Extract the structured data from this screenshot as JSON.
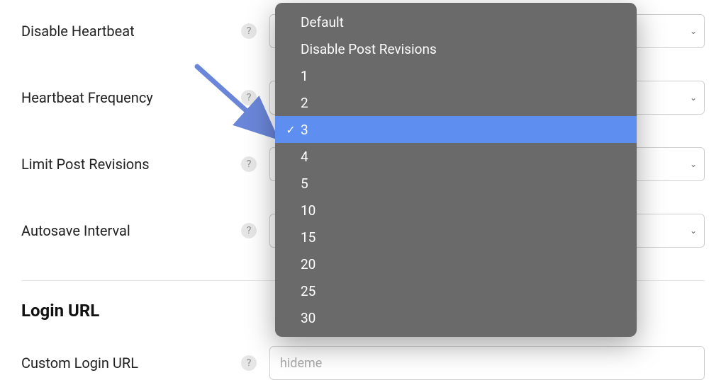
{
  "rows": [
    {
      "label": "Disable Heartbeat"
    },
    {
      "label": "Heartbeat Frequency"
    },
    {
      "label": "Limit Post Revisions"
    },
    {
      "label": "Autosave Interval"
    }
  ],
  "section_title": "Login URL",
  "custom_login": {
    "label": "Custom Login URL",
    "value": "hideme"
  },
  "dropdown": {
    "selected": "3",
    "options": [
      "Default",
      "Disable Post Revisions",
      "1",
      "2",
      "3",
      "4",
      "5",
      "10",
      "15",
      "20",
      "25",
      "30"
    ]
  },
  "arrow_color": "#6a86d9"
}
